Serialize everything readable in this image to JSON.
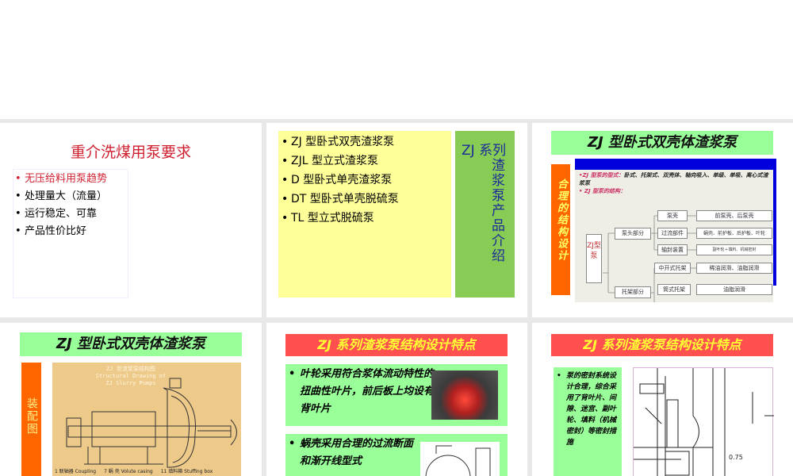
{
  "slides": [
    {
      "title": "重介洗煤用泵要求",
      "bullets": [
        "无压给料用泵趋势",
        "处理量大（流量）",
        "运行稳定、可靠",
        "产品性价比好"
      ]
    },
    {
      "bullets": [
        "ZJ 型卧式双壳渣浆泵",
        "ZJL 型立式渣浆泵",
        "D 型卧式单壳渣浆泵",
        "DT 型卧式单壳脱硫泵",
        "TL 型立式脱硫泵"
      ],
      "side_head": "ZJ 系列",
      "side_rest": "渣浆泵产品介绍"
    },
    {
      "title": "ZJ 型卧式双壳体渣浆泵",
      "side": "合理的结构设计",
      "line1": "•ZJ 型泵的型式：",
      "line1b": "卧式、托架式、双壳体、轴向吸入、单级、单吸、离心式渣浆泵",
      "line2": "• ZJ 型泵的结构：",
      "root": "ZJ型泵",
      "tree": {
        "pump_head": "泵头部分",
        "bracket": "托架部分",
        "casing": "泵壳",
        "casing_d": "前泵壳、后泵壳",
        "wet": "过流部件",
        "wet_d": "蜗壳、前护板、后护板、叶轮",
        "seal": "轴封装置",
        "seal_d": "副叶轮＋填料、机械密封",
        "mid": "中开式托架",
        "mid_d": "稀油润滑、油脂润滑",
        "tube": "筒式托架",
        "tube_d": "油脂润滑"
      }
    },
    {
      "title": "ZJ 型卧式双壳体渣浆泵",
      "side": "装配图",
      "drawing_title": "ZJ 型渣浆泵结构图",
      "drawing_sub1": "Structural Drawing of",
      "drawing_sub2": "ZJ Slurry Pumps",
      "captions": [
        "1 联轴器 Coupling",
        "7 蜗 壳 Volute casing",
        "11 填料箱 Stuffing box"
      ]
    },
    {
      "title": "ZJ 系列渣浆泵结构设计特点",
      "b1": "叶轮采用符合浆体流动特性的扭曲性叶片，前后板上均设有背叶片",
      "b2": "蜗壳采用合理的过流断面和渐开线型式"
    },
    {
      "title": "ZJ 系列渣浆泵结构设计特点",
      "b1": "泵的密封系统设计合理，综合采用了背叶片、间隙、迷宫、副叶轮、填料（机械密封）等密封措施",
      "dim": "0.75"
    }
  ],
  "colors": {
    "red": "#e0202a",
    "green": "#99ff99",
    "yellow": "#ffff99",
    "orange": "#ff6600",
    "blue": "#0000dd"
  }
}
